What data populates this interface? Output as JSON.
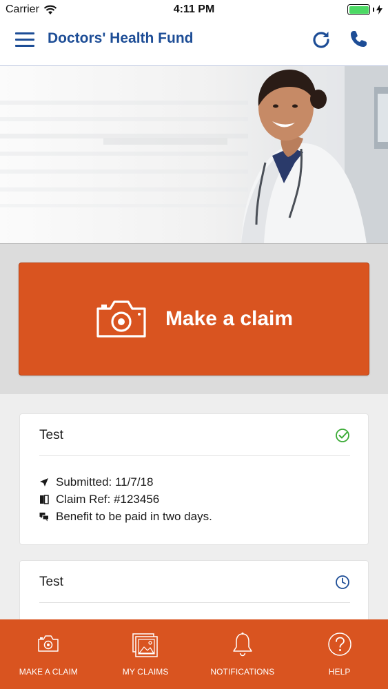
{
  "status_bar": {
    "carrier": "Carrier",
    "time": "4:11 PM"
  },
  "header": {
    "title": "Doctors' Health Fund",
    "menu_icon": "hamburger-menu-icon",
    "refresh_icon": "refresh-icon",
    "phone_icon": "phone-icon"
  },
  "claim_button": {
    "label": "Make a claim",
    "icon": "camera-icon"
  },
  "claims": [
    {
      "title": "Test",
      "status_icon": "check-circle-icon",
      "details": [
        {
          "icon": "send-icon",
          "text": "Submitted: 11/7/18"
        },
        {
          "icon": "reference-icon",
          "text": "Claim Ref: #123456"
        },
        {
          "icon": "chat-icon",
          "text": "Benefit to be paid in two days."
        }
      ]
    },
    {
      "title": "Test",
      "status_icon": "clock-icon"
    }
  ],
  "colors": {
    "brand_orange": "#d95420",
    "brand_blue": "#1d4d96",
    "success_green": "#3aaa35"
  },
  "tabs": [
    {
      "label": "MAKE A CLAIM",
      "icon": "camera-icon"
    },
    {
      "label": "MY CLAIMS",
      "icon": "photos-icon"
    },
    {
      "label": "NOTIFICATIONS",
      "icon": "bell-icon"
    },
    {
      "label": "HELP",
      "icon": "help-icon"
    }
  ]
}
